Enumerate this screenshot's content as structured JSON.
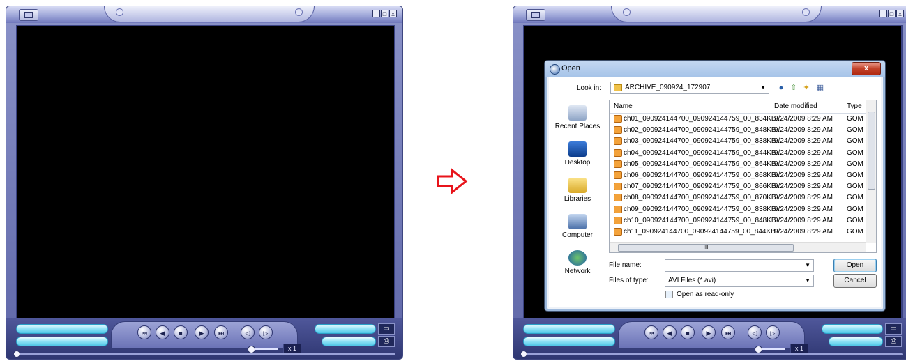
{
  "player": {
    "window_buttons": [
      "_",
      "□",
      "x"
    ],
    "speed": "x 1",
    "side_icons": [
      "open-folder-icon",
      "print-icon"
    ],
    "playback_buttons": [
      {
        "name": "skip-back-icon",
        "glyph": "⏮"
      },
      {
        "name": "rewind-icon",
        "glyph": "◀"
      },
      {
        "name": "stop-icon",
        "glyph": "■"
      },
      {
        "name": "play-icon",
        "glyph": "▶"
      },
      {
        "name": "skip-forward-icon",
        "glyph": "⏭"
      },
      {
        "name": "frame-back-icon",
        "glyph": "◁"
      },
      {
        "name": "frame-forward-icon",
        "glyph": "▷"
      }
    ]
  },
  "arrow_color": "#e8141b",
  "dialog": {
    "title": "Open",
    "close_label": "x",
    "look_in_label": "Look in:",
    "look_in_value": "ARCHIVE_090924_172907",
    "places": [
      "Recent Places",
      "Desktop",
      "Libraries",
      "Computer",
      "Network"
    ],
    "columns": {
      "name": "Name",
      "date": "Date modified",
      "type": "Type"
    },
    "files": [
      {
        "name": "ch01_090924144700_090924144759_00_834KB...",
        "date": "9/24/2009 8:29 AM",
        "type": "GOM I"
      },
      {
        "name": "ch02_090924144700_090924144759_00_848KB...",
        "date": "9/24/2009 8:29 AM",
        "type": "GOM I"
      },
      {
        "name": "ch03_090924144700_090924144759_00_838KB...",
        "date": "9/24/2009 8:29 AM",
        "type": "GOM I"
      },
      {
        "name": "ch04_090924144700_090924144759_00_844KB...",
        "date": "9/24/2009 8:29 AM",
        "type": "GOM I"
      },
      {
        "name": "ch05_090924144700_090924144759_00_864KB...",
        "date": "9/24/2009 8:29 AM",
        "type": "GOM I"
      },
      {
        "name": "ch06_090924144700_090924144759_00_868KB...",
        "date": "9/24/2009 8:29 AM",
        "type": "GOM I"
      },
      {
        "name": "ch07_090924144700_090924144759_00_866KB...",
        "date": "9/24/2009 8:29 AM",
        "type": "GOM I"
      },
      {
        "name": "ch08_090924144700_090924144759_00_870KB...",
        "date": "9/24/2009 8:29 AM",
        "type": "GOM I"
      },
      {
        "name": "ch09_090924144700_090924144759_00_838KB...",
        "date": "9/24/2009 8:29 AM",
        "type": "GOM I"
      },
      {
        "name": "ch10_090924144700_090924144759_00_848KB...",
        "date": "9/24/2009 8:29 AM",
        "type": "GOM I"
      },
      {
        "name": "ch11_090924144700_090924144759_00_844KB...",
        "date": "9/24/2009 8:29 AM",
        "type": "GOM I"
      }
    ],
    "hscroll_label": "III",
    "file_name_label": "File name:",
    "file_name_value": "",
    "files_of_type_label": "Files of type:",
    "files_of_type_value": "AVI Files (*.avi)",
    "open_label": "Open",
    "cancel_label": "Cancel",
    "readonly_label": "Open as read-only"
  }
}
